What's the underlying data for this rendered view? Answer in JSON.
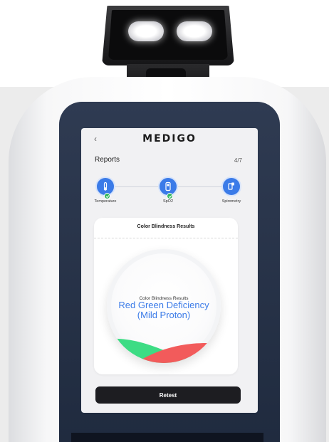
{
  "header": {
    "back_glyph": "‹",
    "logo_text": "MEDIGO"
  },
  "reports": {
    "title": "Reports",
    "count": "4/7"
  },
  "steps": [
    {
      "label": "Temperature",
      "icon": "thermometer-icon",
      "completed": true
    },
    {
      "label": "SpO2",
      "icon": "pulse-oximeter-icon",
      "completed": true
    },
    {
      "label": "Spirometry",
      "icon": "spirometer-icon",
      "completed": false
    }
  ],
  "result_card": {
    "title": "Color Blindness Results",
    "dial_label": "Color Blindness Results",
    "result_line1": "Red Green Deficiency",
    "result_line2": "(Mild Proton)"
  },
  "actions": {
    "retest_label": "Retest"
  },
  "colors": {
    "accent_blue": "#3b7be8",
    "check_green": "#30b55d",
    "wave_green": "#3ddc84",
    "wave_red": "#f25b5b",
    "button_dark": "#1d1d21"
  }
}
